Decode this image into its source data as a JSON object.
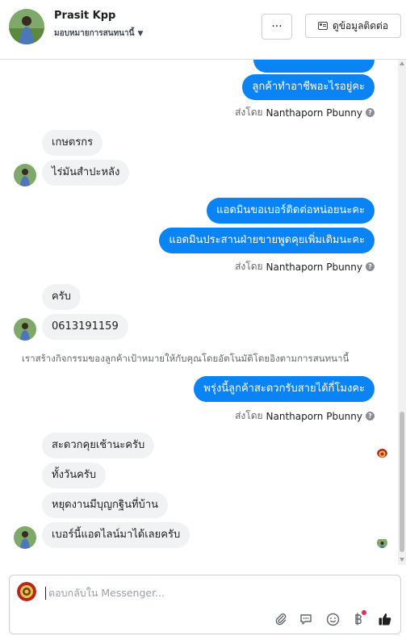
{
  "header": {
    "name": "Prasit Kpp",
    "subtitle": "มอบหมายการสนทนานี้",
    "more_label": "···",
    "contact_label": "ดูข้อมูลติดต่อ"
  },
  "messages": {
    "out_1": "ลูกค้าทำอาชีพอะไรอยู่คะ",
    "sent_by_label": "ส่งโดย",
    "sender_name": "Nanthaporn Pbunny",
    "in_1": "เกษตรกร",
    "in_2": "ไร่มันสำปะหลัง",
    "out_2": "แอดมินขอเบอร์ติดต่อหน่อยนะคะ",
    "out_3": "แอดมินประสานฝ่ายขายพูดคุยเพิ่มเติมนะคะ",
    "in_3": "ครับ",
    "in_4": "0613191159",
    "system_note": "เราสร้างกิจกรรมของลูกค้าเป้าหมายให้กับคุณโดยอัตโนมัติโดยอิงตามการสนทนานี้",
    "out_4": "พรุ่งนี้ลูกค้าสะดวกรับสายได้กี่โมงคะ",
    "in_5": "สะดวกคุยเช้านะครับ",
    "in_6": "ทั้งวันครับ",
    "in_7": "หยุดงานมีบุญกฐินที่บ้าน",
    "in_8": "เบอร์นี้แอดไลน์มาได้เลยครับ"
  },
  "composer": {
    "placeholder": "ตอบกลับใน Messenger..."
  },
  "icons": {
    "attach": "paperclip-icon",
    "saved_replies": "chat-bubble-icon",
    "emoji": "smiley-icon",
    "payment": "baht-icon",
    "like": "thumbs-up-icon"
  },
  "colors": {
    "outgoing_bubble": "#0a84f5",
    "incoming_bubble": "#f1f2f3",
    "notification_dot": "#f02849"
  }
}
